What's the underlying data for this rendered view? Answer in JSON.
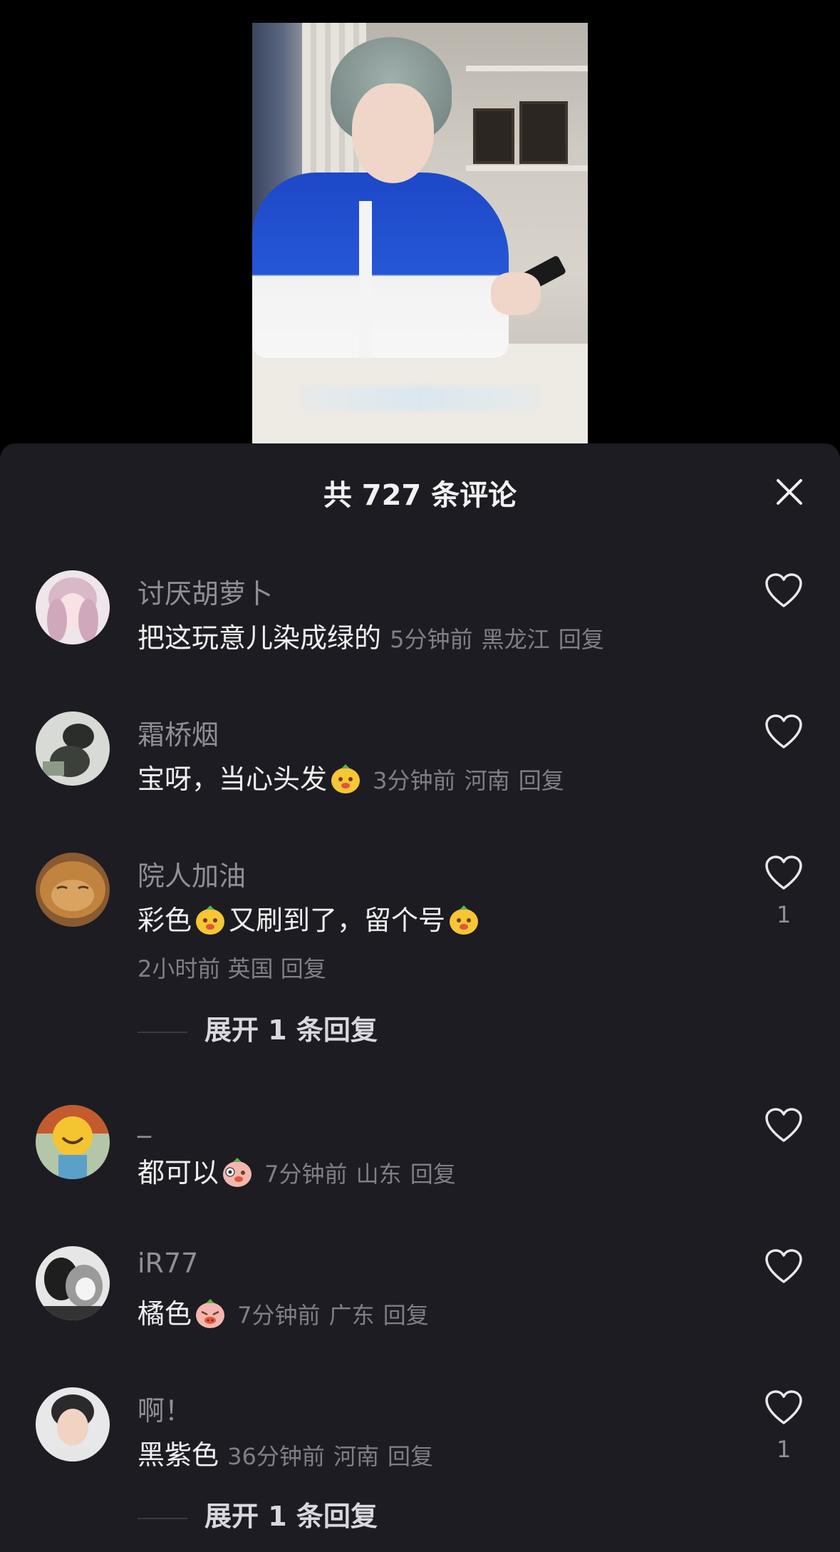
{
  "header": {
    "title": "共 727 条评论"
  },
  "comments": [
    {
      "username": "讨厌胡萝卜",
      "parts": [
        "把这玩意儿染成绿的"
      ],
      "time": "5分钟前",
      "location": "黑龙江",
      "reply": "回复",
      "likes": ""
    },
    {
      "username": "霜桥烟",
      "parts": [
        "宝呀，当心头发"
      ],
      "time": "3分钟前",
      "location": "河南",
      "reply": "回复",
      "likes": ""
    },
    {
      "username": "院人加油",
      "parts": [
        "彩色",
        "又刷到了，留个号"
      ],
      "time": "2小时前",
      "location": "英国",
      "reply": "回复",
      "likes": "1",
      "expand": "展开 1 条回复"
    },
    {
      "username": "_",
      "parts": [
        "都可以"
      ],
      "time": "7分钟前",
      "location": "山东",
      "reply": "回复",
      "likes": ""
    },
    {
      "username": "iR77",
      "parts": [
        "橘色"
      ],
      "time": "7分钟前",
      "location": "广东",
      "reply": "回复",
      "likes": ""
    },
    {
      "username": "啊！",
      "parts": [
        "黑紫色"
      ],
      "time": "36分钟前",
      "location": "河南",
      "reply": "回复",
      "likes": "1",
      "expand": "展开 1 条回复"
    }
  ],
  "icons": {
    "close": "close-icon",
    "like": "heart-outline-icon",
    "emoji": "smile-face-emoji"
  },
  "colors": {
    "sheet_bg": "#1c1c22",
    "meta": "#7f7f86",
    "text": "#f0f0f0"
  }
}
